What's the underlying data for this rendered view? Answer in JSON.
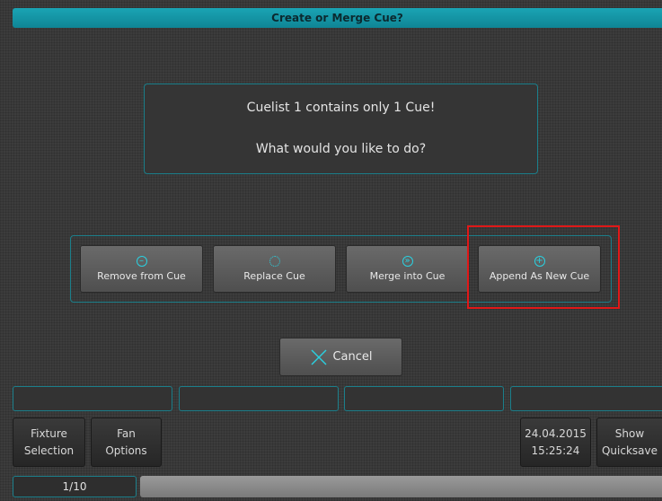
{
  "dialog": {
    "title": "Create or Merge Cue?",
    "message_line1": "Cuelist 1 contains only 1 Cue!",
    "message_line2": "What would you like to do?"
  },
  "options": [
    {
      "label": "Remove from Cue",
      "icon": "minus-circle-icon"
    },
    {
      "label": "Replace Cue",
      "icon": "refresh-circle-icon"
    },
    {
      "label": "Merge into Cue",
      "icon": "merge-circle-icon"
    },
    {
      "label": "Append As New Cue",
      "icon": "plus-circle-icon"
    }
  ],
  "cancel": {
    "label": "Cancel",
    "icon": "x-icon"
  },
  "footer": {
    "fixture_selection": {
      "line1": "Fixture",
      "line2": "Selection"
    },
    "fan_options": {
      "line1": "Fan",
      "line2": "Options"
    },
    "date": "24.04.2015",
    "time": "15:25:24",
    "show_quicksave": {
      "line1": "Show",
      "line2": "Quicksave"
    },
    "page": "1/10"
  },
  "colors": {
    "accent": "#1aa4b4",
    "highlight": "#e01818"
  }
}
